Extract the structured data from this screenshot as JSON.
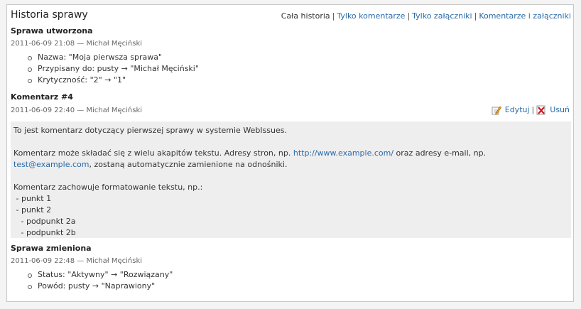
{
  "header": {
    "title": "Historia sprawy",
    "filters": [
      {
        "label": "Cała historia",
        "active": true
      },
      {
        "label": "Tylko komentarze",
        "active": false
      },
      {
        "label": "Tylko załączniki",
        "active": false
      },
      {
        "label": "Komentarze i załączniki",
        "active": false
      }
    ],
    "separator": "|"
  },
  "created": {
    "title": "Sprawa utworzona",
    "meta": "2011-06-09 21:08 — Michał Męciński",
    "changes": [
      "Nazwa: \"Moja pierwsza sprawa\"",
      "Przypisany do: pusty → \"Michał Męciński\"",
      "Krytyczność: \"2\" → \"1\""
    ]
  },
  "comment": {
    "title": "Komentarz #4",
    "meta": "2011-06-09 22:40 — Michał Męciński",
    "edit_label": "Edytuj",
    "delete_label": "Usuń",
    "action_separator": "|",
    "line1": "To jest komentarz dotyczący pierwszej sprawy w systemie WebIssues.",
    "line2_pre": "Komentarz może składać się z wielu akapitów tekstu. Adresy stron, np. ",
    "line2_link": "http://www.example.com/",
    "line2_post": " oraz adresy e-mail, np.",
    "line3_link": "test@example.com",
    "line3_post": ", zostaną automatycznie zamienione na odnośniki.",
    "line4": "Komentarz zachowuje formatowanie tekstu, np.:",
    "line5": " - punkt 1",
    "line6": " - punkt 2",
    "line7": "   - podpunkt 2a",
    "line8": "   - podpunkt 2b"
  },
  "changed": {
    "title": "Sprawa zmieniona",
    "meta": "2011-06-09 22:48 — Michał Męciński",
    "changes": [
      "Status: \"Aktywny\" → \"Rozwiązany\"",
      "Powód: pusty → \"Naprawiony\""
    ]
  },
  "colors": {
    "link": "#2a6aa8",
    "comment_bg": "#eeeeee",
    "border": "#c8c8c8"
  }
}
